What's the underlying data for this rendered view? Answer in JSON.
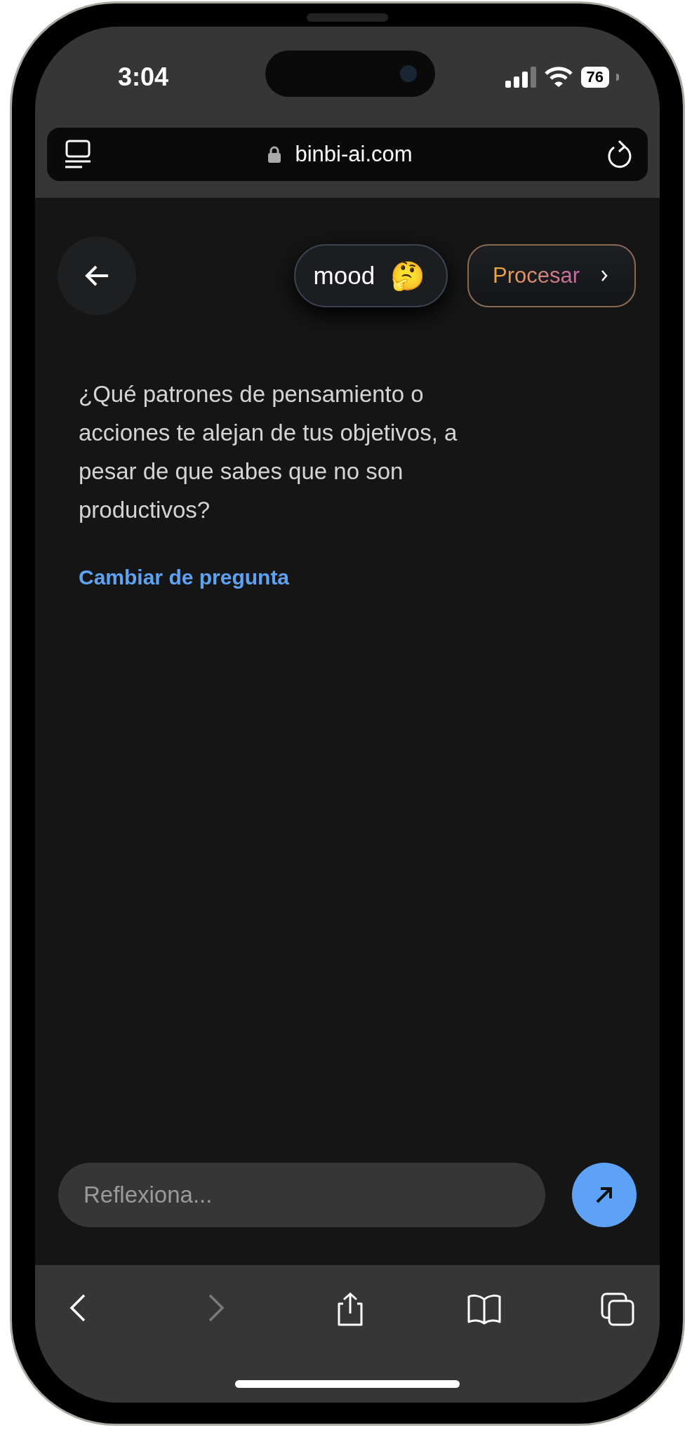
{
  "status_bar": {
    "time": "3:04",
    "battery": "76"
  },
  "address_bar": {
    "url": "binbi-ai.com"
  },
  "header": {
    "mood": {
      "label": "mood",
      "emoji": "🤔"
    },
    "process_button": "Procesar"
  },
  "question": {
    "text": "¿Qué patrones de pensamiento o acciones te alejan de tus objetivos, a pesar de que sabes que no son productivos?",
    "change_link": "Cambiar de pregunta"
  },
  "composer": {
    "placeholder": "Reflexiona..."
  },
  "toolbar": {
    "items": [
      {
        "kind": "back",
        "disabled": false
      },
      {
        "kind": "forward",
        "disabled": true
      },
      {
        "kind": "share",
        "disabled": false
      },
      {
        "kind": "bookmarks",
        "disabled": false
      },
      {
        "kind": "tabs",
        "disabled": false
      }
    ]
  }
}
